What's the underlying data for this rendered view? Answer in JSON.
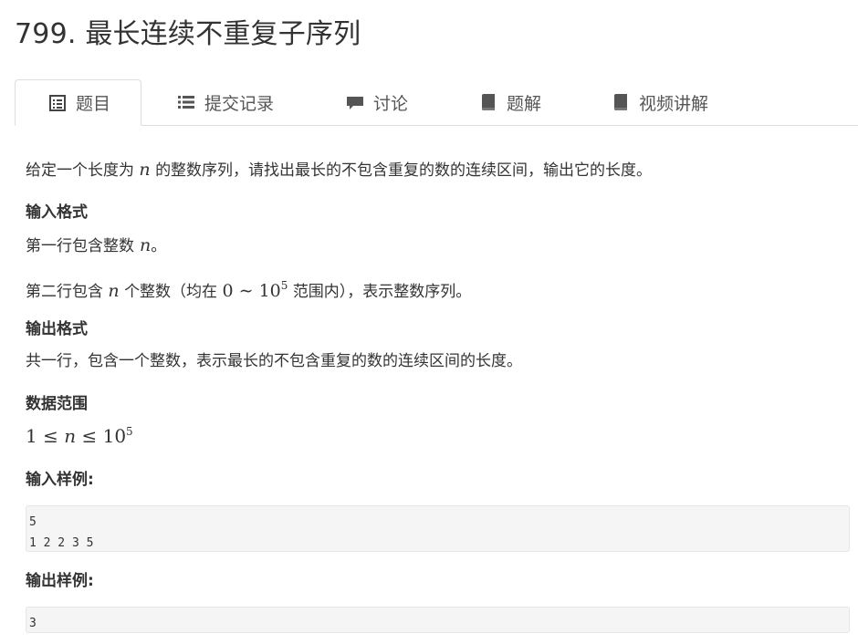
{
  "problem": {
    "title": "799. 最长连续不重复子序列"
  },
  "tabs": [
    {
      "label": "题目",
      "icon": "document-list-icon"
    },
    {
      "label": "提交记录",
      "icon": "list-icon"
    },
    {
      "label": "讨论",
      "icon": "comment-icon"
    },
    {
      "label": "题解",
      "icon": "book-icon"
    },
    {
      "label": "视频讲解",
      "icon": "book-icon"
    }
  ],
  "description": {
    "intro_a": "给定一个长度为",
    "var_n": "n",
    "intro_b": "的整数序列，请找出最长的不包含重复的数的连续区间，输出它的长度。"
  },
  "input_format": {
    "heading": "输入格式",
    "line1_a": "第一行包含整数",
    "line1_b": "。",
    "line2_a": "第二行包含",
    "line2_b": "个整数（均在",
    "range_low": "0",
    "sim": "∼",
    "base": "10",
    "exp": "5",
    "line2_c": "范围内），表示整数序列。"
  },
  "output_format": {
    "heading": "输出格式",
    "text": "共一行，包含一个整数，表示最长的不包含重复的数的连续区间的长度。"
  },
  "data_range": {
    "heading": "数据范围",
    "one": "1",
    "leq": "≤",
    "base": "10",
    "exp": "5"
  },
  "sample_input": {
    "heading": "输入样例:",
    "code": "5\n1 2 2 3 5"
  },
  "sample_output": {
    "heading": "输出样例:",
    "code": "3"
  }
}
